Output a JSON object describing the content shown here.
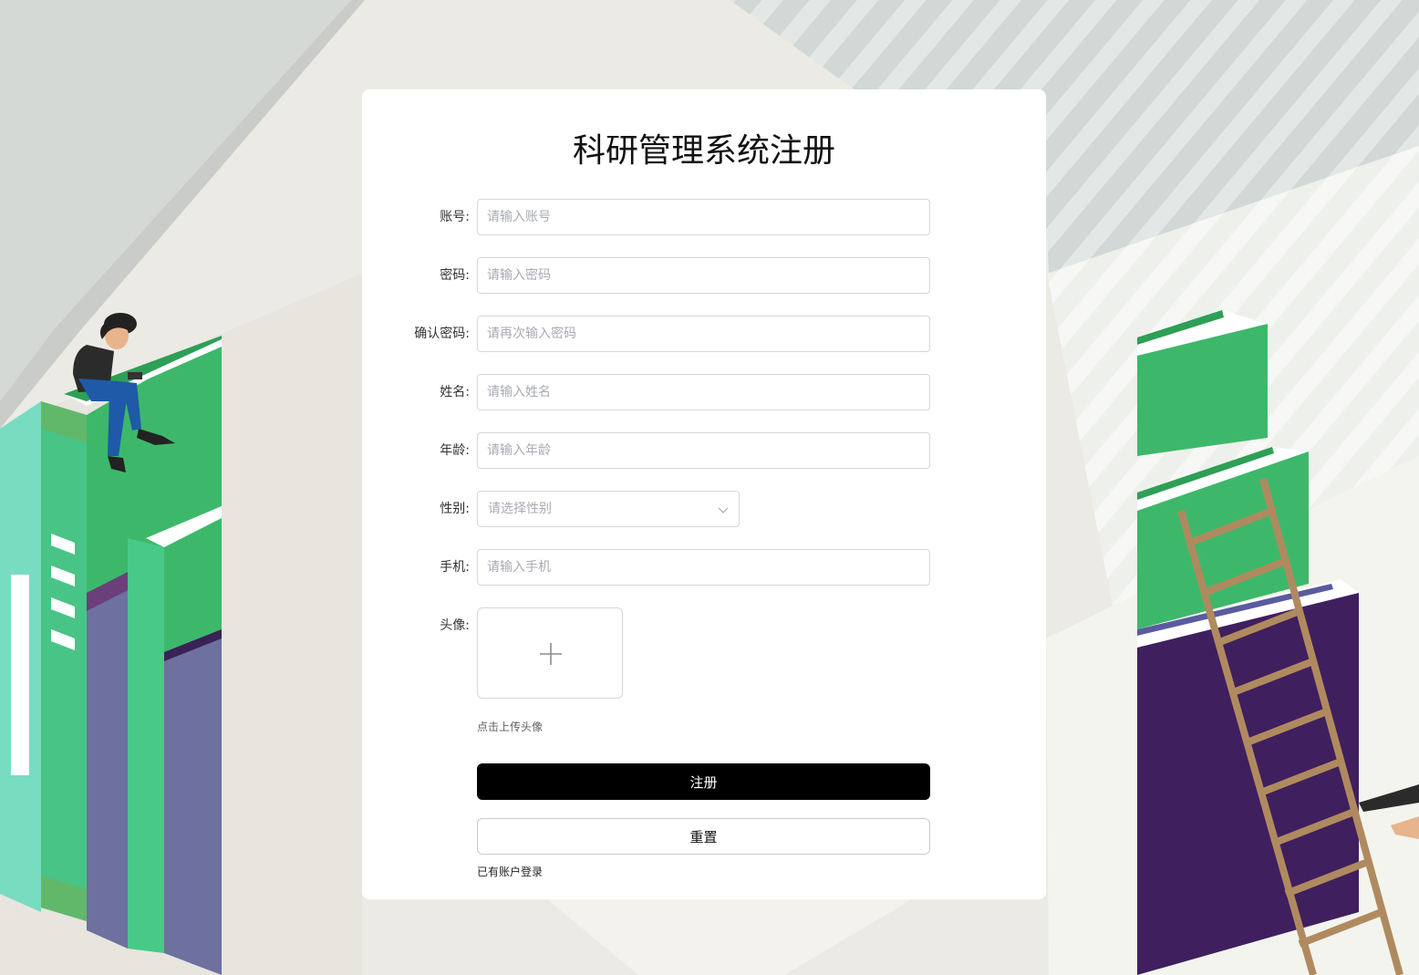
{
  "form": {
    "title": "科研管理系统注册",
    "fields": {
      "account": {
        "label": "账号:",
        "placeholder": "请输入账号"
      },
      "password": {
        "label": "密码:",
        "placeholder": "请输入密码"
      },
      "confirm": {
        "label": "确认密码:",
        "placeholder": "请再次输入密码"
      },
      "name": {
        "label": "姓名:",
        "placeholder": "请输入姓名"
      },
      "age": {
        "label": "年龄:",
        "placeholder": "请输入年龄"
      },
      "gender": {
        "label": "性别:",
        "placeholder": "请选择性别"
      },
      "phone": {
        "label": "手机:",
        "placeholder": "请输入手机"
      },
      "avatar": {
        "label": "头像:",
        "tip": "点击上传头像"
      }
    },
    "register_label": "注册",
    "reset_label": "重置",
    "login_link": "已有账户登录"
  },
  "colors": {
    "primary_button": "#000000",
    "book_green": "#3db86a",
    "book_purple": "#3f1f5e"
  }
}
